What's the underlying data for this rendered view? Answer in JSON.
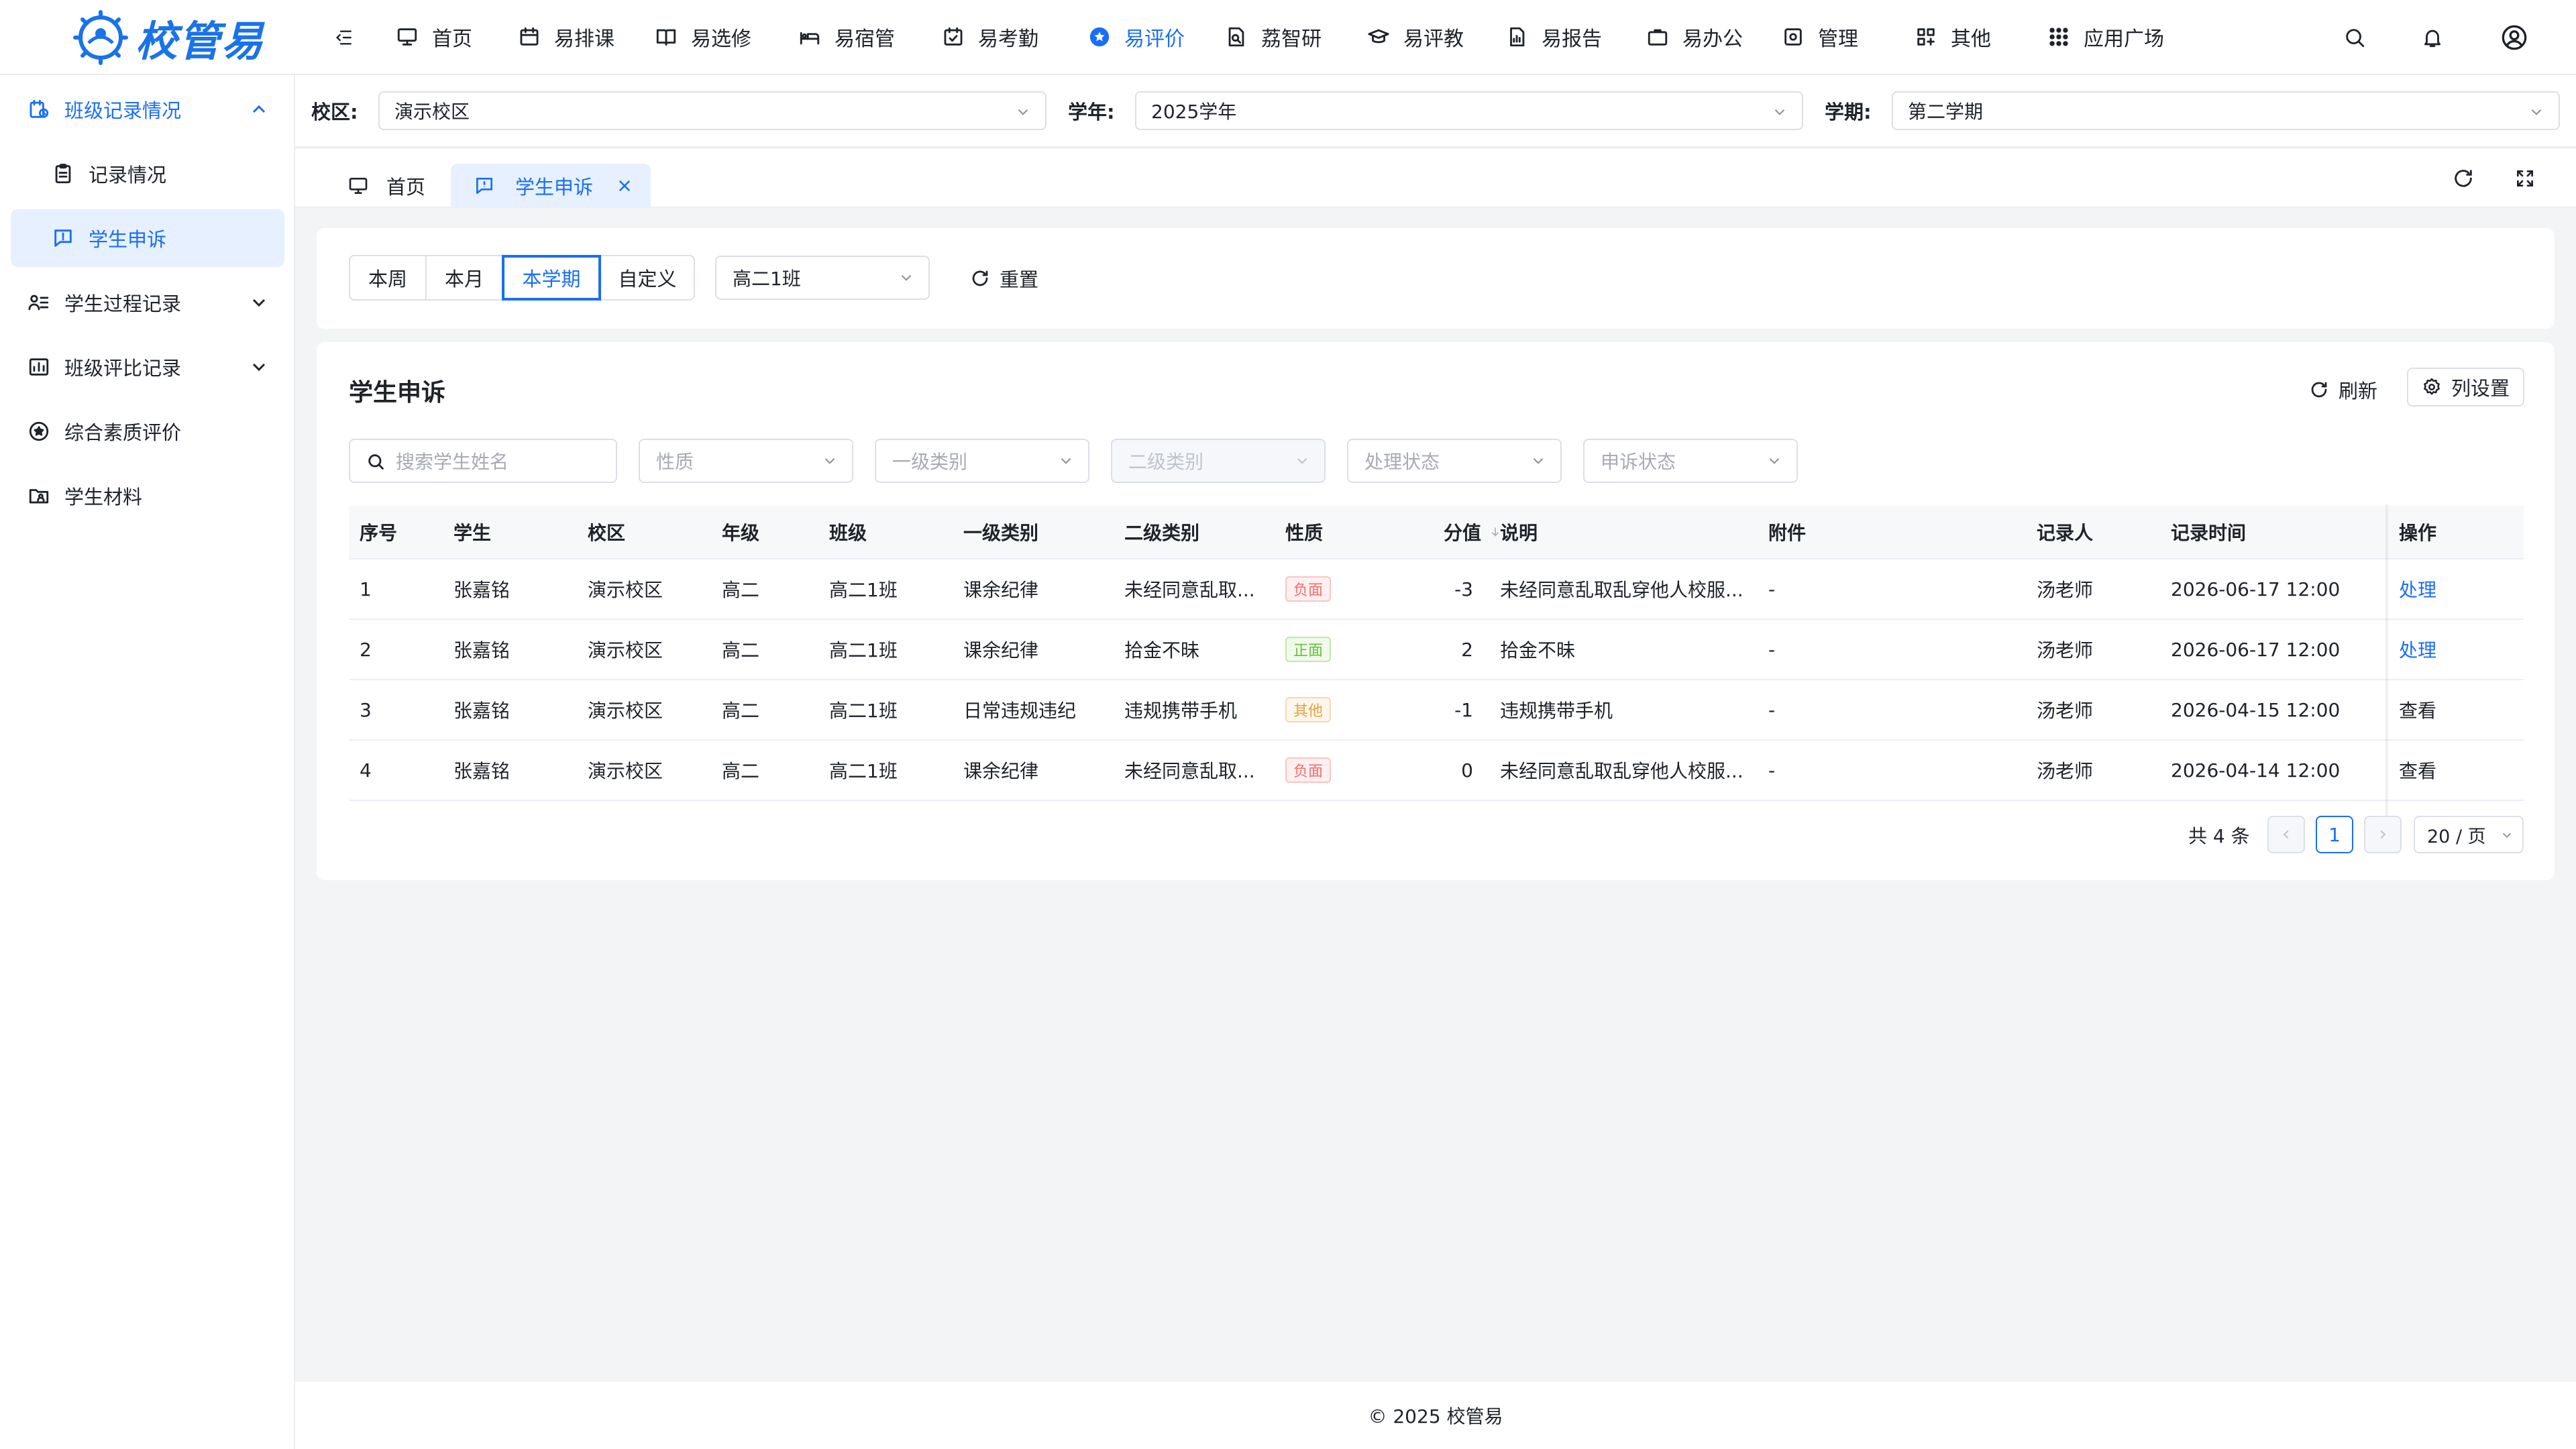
{
  "app": {
    "logo_text": "校管易",
    "brand_color": "#1a6ef5"
  },
  "topnav": {
    "items": [
      {
        "label": "首页",
        "icon": "monitor-icon"
      },
      {
        "label": "易排课",
        "icon": "calendar-icon"
      },
      {
        "label": "易选修",
        "icon": "book-icon"
      },
      {
        "label": "易宿管",
        "icon": "bed-icon"
      },
      {
        "label": "易考勤",
        "icon": "check-calendar-icon"
      },
      {
        "label": "易评价",
        "icon": "star-circle-icon",
        "active": true
      },
      {
        "label": "荔智研",
        "icon": "research-icon"
      },
      {
        "label": "易评教",
        "icon": "graduation-cap-icon"
      },
      {
        "label": "易报告",
        "icon": "report-icon"
      },
      {
        "label": "易办公",
        "icon": "briefcase-icon"
      },
      {
        "label": "管理",
        "icon": "settings-icon"
      },
      {
        "label": "其他",
        "icon": "grid-icon"
      },
      {
        "label": "应用广场",
        "icon": "apps-icon"
      }
    ]
  },
  "sidebar": {
    "items": [
      {
        "label": "班级记录情况",
        "icon": "class-record-icon",
        "expanded": true
      },
      {
        "label": "记录情况",
        "icon": "clipboard-icon",
        "sub": true
      },
      {
        "label": "学生申诉",
        "icon": "appeal-icon",
        "sub": true,
        "selected": true
      },
      {
        "label": "学生过程记录",
        "icon": "student-list-icon",
        "expandable": true
      },
      {
        "label": "班级评比记录",
        "icon": "ranking-icon",
        "expandable": true
      },
      {
        "label": "综合素质评价",
        "icon": "star-badge-icon"
      },
      {
        "label": "学生材料",
        "icon": "folder-user-icon"
      }
    ]
  },
  "filters": {
    "campus_label": "校区:",
    "campus_value": "演示校区",
    "year_label": "学年:",
    "year_value": "2025学年",
    "term_label": "学期:",
    "term_value": "第二学期"
  },
  "tabs": {
    "home_label": "首页",
    "current_label": "学生申诉"
  },
  "period": {
    "options": [
      "本周",
      "本月",
      "本学期",
      "自定义"
    ],
    "selected": "本学期",
    "class_value": "高二1班",
    "reset_label": "重置"
  },
  "panel": {
    "title": "学生申诉",
    "refresh_label": "刷新",
    "columns_label": "列设置",
    "search_placeholder": "搜索学生姓名",
    "nature_placeholder": "性质",
    "cat1_placeholder": "一级类别",
    "cat2_placeholder": "二级类别",
    "process_placeholder": "处理状态",
    "appeal_placeholder": "申诉状态"
  },
  "table": {
    "headers": [
      "序号",
      "学生",
      "校区",
      "年级",
      "班级",
      "一级类别",
      "二级类别",
      "性质",
      "分值",
      "说明",
      "附件",
      "记录人",
      "记录时间",
      "操作"
    ],
    "rows": [
      {
        "no": "1",
        "student": "张嘉铭",
        "campus": "演示校区",
        "grade": "高二",
        "class": "高二1班",
        "cat1": "课余纪律",
        "cat2": "未经同意乱取...",
        "nature": "负面",
        "nature_type": "neg",
        "score": "-3",
        "desc": "未经同意乱取乱穿他人校服...",
        "attach": "-",
        "recorder": "汤老师",
        "time": "2026-06-17 12:00",
        "action": "处理",
        "action_link": true
      },
      {
        "no": "2",
        "student": "张嘉铭",
        "campus": "演示校区",
        "grade": "高二",
        "class": "高二1班",
        "cat1": "课余纪律",
        "cat2": "拾金不昧",
        "nature": "正面",
        "nature_type": "pos",
        "score": "2",
        "desc": "拾金不昧",
        "attach": "-",
        "recorder": "汤老师",
        "time": "2026-06-17 12:00",
        "action": "处理",
        "action_link": true
      },
      {
        "no": "3",
        "student": "张嘉铭",
        "campus": "演示校区",
        "grade": "高二",
        "class": "高二1班",
        "cat1": "日常违规违纪",
        "cat2": "违规携带手机",
        "nature": "其他",
        "nature_type": "oth",
        "score": "-1",
        "desc": "违规携带手机",
        "attach": "-",
        "recorder": "汤老师",
        "time": "2026-04-15 12:00",
        "action": "查看",
        "action_link": false
      },
      {
        "no": "4",
        "student": "张嘉铭",
        "campus": "演示校区",
        "grade": "高二",
        "class": "高二1班",
        "cat1": "课余纪律",
        "cat2": "未经同意乱取...",
        "nature": "负面",
        "nature_type": "neg",
        "score": "0",
        "desc": "未经同意乱取乱穿他人校服...",
        "attach": "-",
        "recorder": "汤老师",
        "time": "2026-04-14 12:00",
        "action": "查看",
        "action_link": false
      }
    ]
  },
  "pagination": {
    "total_text": "共 4 条",
    "current_page": "1",
    "page_size": "20 / 页"
  },
  "footer": {
    "text": "© 2025 校管易"
  }
}
